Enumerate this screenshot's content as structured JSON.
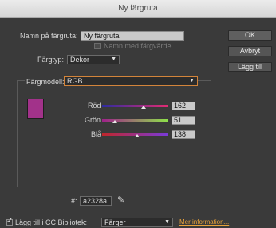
{
  "window": {
    "title": "Ny färgruta"
  },
  "form": {
    "name_label": "Namn på färgruta:",
    "name_value": "Ny färgruta",
    "name_with_value_label": "Namn med färgvärde",
    "type_label": "Färgtyp:",
    "type_value": "Dekor"
  },
  "buttons": {
    "ok": "OK",
    "cancel": "Avbryt",
    "add": "Lägg till"
  },
  "color_model": {
    "label": "Färgmodell:",
    "value": "RGB",
    "swatch_color": "#a2328a",
    "channels": [
      {
        "label": "Röd",
        "value": "162",
        "fraction": 0.635
      },
      {
        "label": "Grön",
        "value": "51",
        "fraction": 0.2
      },
      {
        "label": "Blå",
        "value": "138",
        "fraction": 0.541
      }
    ],
    "hex_label": "#:",
    "hex_value": "a2328a"
  },
  "footer": {
    "library_label": "Lägg till i CC Bibliotek:",
    "library_value": "Färger",
    "more_info": "Mer information..."
  },
  "colors": {
    "accent": "#e8a23a",
    "focus_orange": "#d3843a"
  }
}
